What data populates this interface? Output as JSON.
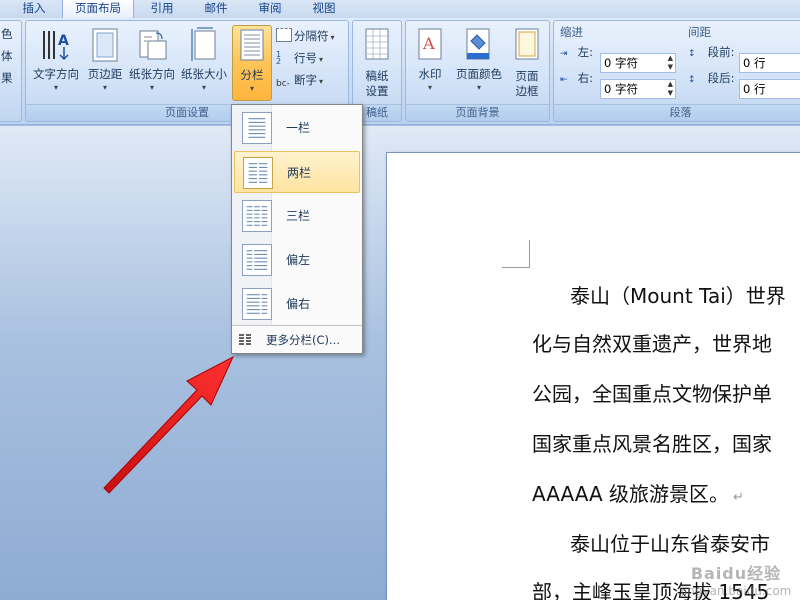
{
  "tabs": [
    {
      "label": "插入",
      "active": false
    },
    {
      "label": "页面布局",
      "active": true
    },
    {
      "label": "引用",
      "active": false
    },
    {
      "label": "邮件",
      "active": false
    },
    {
      "label": "审阅",
      "active": false
    },
    {
      "label": "视图",
      "active": false
    }
  ],
  "ribbon": {
    "page_setup": {
      "group_label": "页面设置",
      "text_direction": "文字方向",
      "margins": "页边距",
      "orientation": "纸张方向",
      "size": "纸张大小",
      "columns": "分栏",
      "breaks": "分隔符",
      "line_numbers": "行号",
      "hyphenation": "断字",
      "partial_left": [
        "色",
        "体",
        "果"
      ]
    },
    "manuscript": {
      "group_label": "稿纸",
      "setup_line1": "稿纸",
      "setup_line2": "设置"
    },
    "page_background": {
      "group_label": "页面背景",
      "watermark": "水印",
      "page_color": "页面颜色",
      "page_borders_line1": "页面",
      "page_borders_line2": "边框"
    },
    "paragraph": {
      "group_label": "段落",
      "indent_title": "缩进",
      "spacing_title": "间距",
      "indent_left_label": "左:",
      "indent_left_value": "0 字符",
      "indent_right_label": "右:",
      "indent_right_value": "0 字符",
      "spacing_before_label": "段前:",
      "spacing_before_value": "0 行",
      "spacing_after_label": "段后:",
      "spacing_after_value": "0 行"
    }
  },
  "columns_menu": {
    "items": [
      {
        "label": "一栏",
        "selected": false
      },
      {
        "label": "两栏",
        "selected": true
      },
      {
        "label": "三栏",
        "selected": false
      },
      {
        "label": "偏左",
        "selected": false
      },
      {
        "label": "偏右",
        "selected": false
      }
    ],
    "more": "更多分栏(C)..."
  },
  "document": {
    "lines": [
      "泰山（Mount Tai）世界",
      "化与自然双重遗产，世界地",
      "公园，全国重点文物保护单",
      "国家重点风景名胜区，国家",
      "AAAAA 级旅游景区。",
      "泰山位于山东省泰安市",
      "部，主峰玉皇顶海拔 1545"
    ]
  },
  "watermark": {
    "line1": "Baidu经验",
    "line2": "jingyan.baidu.com"
  },
  "colors": {
    "arrow": "#e02020",
    "pressed": "#ffc65a",
    "selected_item": "#ffe3a0"
  }
}
